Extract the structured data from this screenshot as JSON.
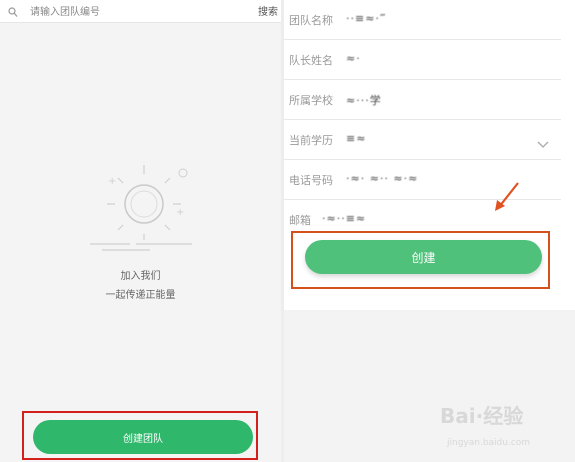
{
  "left_panel": {
    "search": {
      "placeholder": "请输入团队编号",
      "button_label": "搜索"
    },
    "empty_state": {
      "line1": "加入我们",
      "line2": "一起传递正能量"
    },
    "create_team_button": "创建团队"
  },
  "right_panel": {
    "fields": [
      {
        "label": "团队名称",
        "value": "··≡≈·‴"
      },
      {
        "label": "队长姓名",
        "value": "≈·"
      },
      {
        "label": "所属学校",
        "value": "≈···学"
      },
      {
        "label": "当前学历",
        "value": "≡≈"
      },
      {
        "label": "电话号码",
        "value": "·≈· ≈·· ≈·≈"
      },
      {
        "label": "邮箱",
        "value": "·≈··≡≈"
      }
    ],
    "create_button": "创建"
  },
  "watermark": {
    "brand": "Bai·经验",
    "url": "jingyan.baidu.com"
  },
  "colors": {
    "primary_green": "#2fb86b",
    "highlight_red": "#d4201c"
  }
}
